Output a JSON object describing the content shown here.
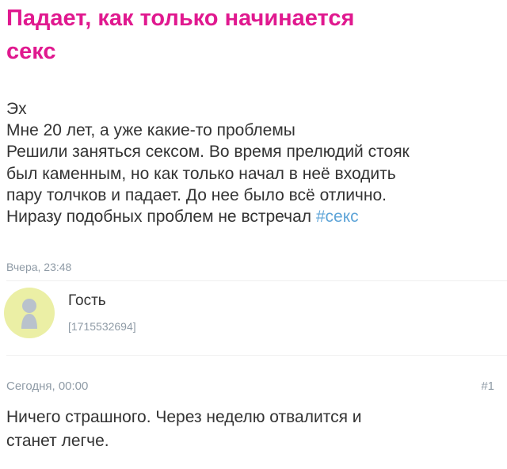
{
  "post": {
    "title_lines": [
      "Падает, как только начинается",
      "секс"
    ],
    "body_lines": [
      "Эх",
      "Мне 20 лет, а уже какие-то проблемы",
      "Решили заняться сексом. Во время прелюдий стояк",
      "был каменным, но как только начал в неё входить",
      "пару толчков и падает. До нее было всё отлично.",
      "Ниразу подобных проблем не встречал "
    ],
    "hashtag": "#секс",
    "time": "Вчера, 23:48"
  },
  "author": {
    "name": "Гость",
    "id": "[1715532694]",
    "avatar_icon": "user-silhouette-icon"
  },
  "comment": {
    "time": "Сегодня, 00:00",
    "number": "#1",
    "text_lines": [
      "Ничего страшного. Через неделю отвалится и",
      "станет легче."
    ]
  },
  "colors": {
    "title": "#e0198f",
    "hashtag": "#5fa5d8",
    "meta": "#8f9ba6",
    "avatar_bg": "#ebefa5",
    "avatar_fg": "#b9c2cc"
  }
}
